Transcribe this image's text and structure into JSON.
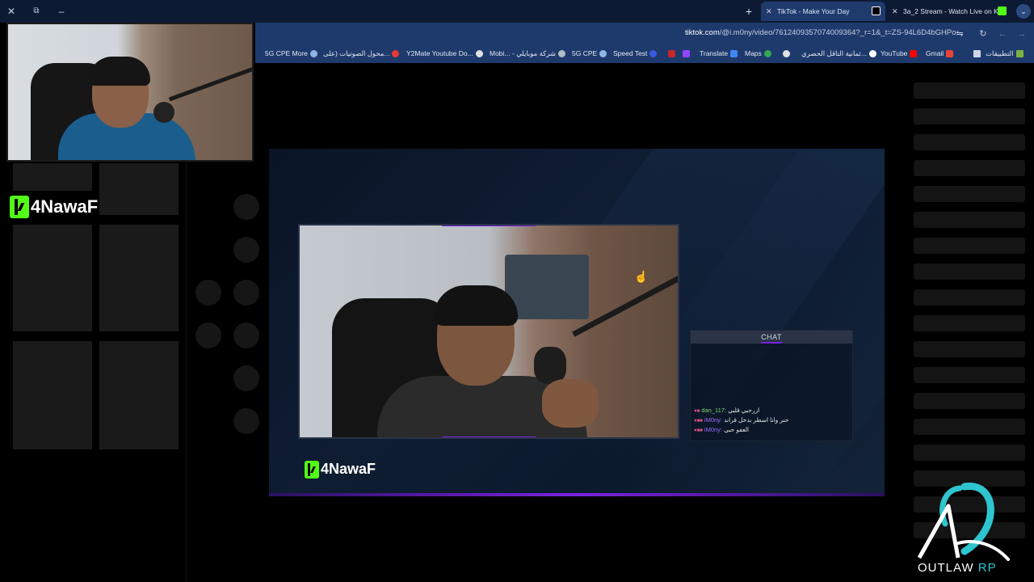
{
  "window": {
    "controls": {
      "close": "✕",
      "restore": "⧉",
      "minimize": "–"
    }
  },
  "tabs": [
    {
      "title": "TikTok - Make Your Day",
      "close": "✕",
      "favicon": "tiktok-icon",
      "active": true
    },
    {
      "title": "3a_2 Stream - Watch Live on Ki",
      "close": "✕",
      "favicon": "kick-icon",
      "active": false
    }
  ],
  "newtab_label": "+",
  "tab_menu_label": "⌄",
  "address": {
    "url_host": "tiktok.com",
    "url_path": "/@i.m0ny/video/7612409357074009364?_r=1&_t=ZS-94L6D4bGHPo"
  },
  "bookmarks": [
    "5G CPE More",
    "محول الصوتيات (علی...",
    "Y2Mate Youtube Do...",
    "Mobi... - شركة موبايلي",
    "5G CPE",
    "Speed Test",
    "Translate",
    "Maps",
    "ثمانية الناقل الحصري...",
    "YouTube",
    "Gmail",
    "التطبيقات"
  ],
  "brand": {
    "channel_name": "4NawaF",
    "accent": "#53fc18"
  },
  "chat": {
    "header": "CHAT",
    "messages": [
      {
        "user": "dan_117:",
        "text": "ازرحبي قلبي",
        "color": "green"
      },
      {
        "user": "iM0ny:",
        "text": "حنر وانا اسطر بدخل قراند",
        "color": "purple"
      },
      {
        "user": "iM0ny:",
        "text": "العفو حبي",
        "color": "purple"
      }
    ]
  },
  "watermark": {
    "word1": "OUTLAW",
    "word2": "RP"
  },
  "colors": {
    "tab_bar": "#0d1a33",
    "toolbar": "#1e3a6c",
    "stream_accent": "#7a22e0"
  }
}
